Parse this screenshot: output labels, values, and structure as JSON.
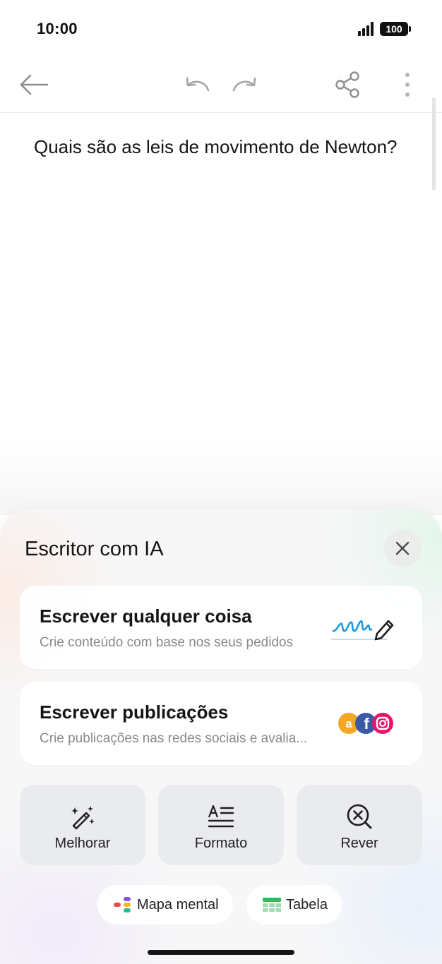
{
  "status_bar": {
    "time": "10:00",
    "signal_icon": "cellular-signal-icon",
    "battery_level": "100"
  },
  "toolbar": {
    "back_icon": "arrow-left-icon",
    "undo_icon": "undo-icon",
    "redo_icon": "redo-icon",
    "share_icon": "share-icon",
    "more_icon": "more-vertical-icon"
  },
  "note": {
    "text": "Quais são as leis de movimento de Newton?"
  },
  "ai_panel": {
    "title": "Escritor com IA",
    "close_icon": "close-icon",
    "cards": [
      {
        "title": "Escrever qualquer coisa",
        "subtitle": "Crie conteúdo com base nos seus pedidos",
        "art_icon": "handwriting-pencil-icon"
      },
      {
        "title": "Escrever publicações",
        "subtitle": "Crie publicações nas redes sociais e avalia...",
        "art_icon": "social-media-icons"
      }
    ],
    "actions": [
      {
        "label": "Melhorar",
        "icon": "magic-wand-icon"
      },
      {
        "label": "Formato",
        "icon": "text-format-icon"
      },
      {
        "label": "Rever",
        "icon": "review-search-icon"
      }
    ],
    "chips": [
      {
        "label": "Mapa mental",
        "icon": "mind-map-icon"
      },
      {
        "label": "Tabela",
        "icon": "table-icon"
      }
    ]
  },
  "colors": {
    "accent_blue": "#1a9be0",
    "amazon_orange": "#f5a623",
    "facebook_blue": "#3b5aa6",
    "instagram_pink": "#e8156c",
    "table_green": "#2ebd59"
  }
}
